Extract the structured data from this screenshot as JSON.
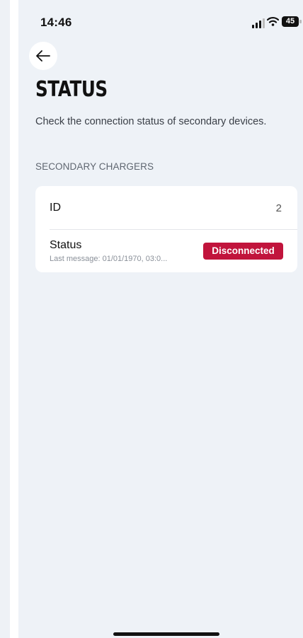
{
  "status_bar": {
    "time": "14:46",
    "battery": "45"
  },
  "page": {
    "title": "STATUS",
    "subtitle": "Check the connection status of secondary devices."
  },
  "section": {
    "label": "SECONDARY CHARGERS"
  },
  "card": {
    "id_label": "ID",
    "id_value": "2",
    "status_label": "Status",
    "status_sub": "Last message: 01/01/1970, 03:0...",
    "status_badge": "Disconnected"
  },
  "colors": {
    "badge": "#c1143c",
    "background": "#eef2f7"
  }
}
